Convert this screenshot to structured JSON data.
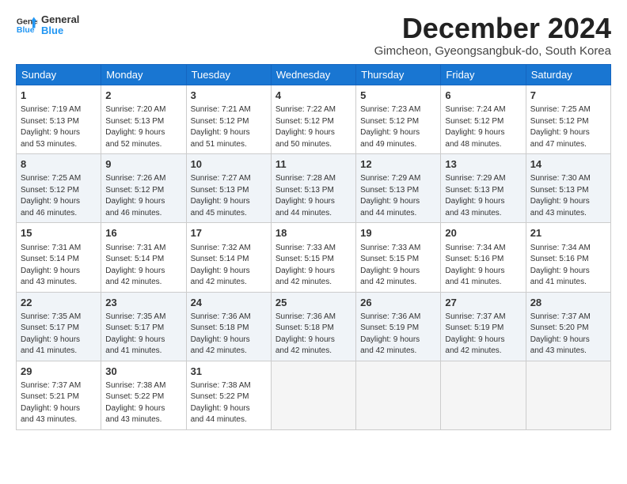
{
  "logo": {
    "line1": "General",
    "line2": "Blue"
  },
  "header": {
    "month": "December 2024",
    "location": "Gimcheon, Gyeongsangbuk-do, South Korea"
  },
  "weekdays": [
    "Sunday",
    "Monday",
    "Tuesday",
    "Wednesday",
    "Thursday",
    "Friday",
    "Saturday"
  ],
  "weeks": [
    [
      {
        "day": "1",
        "info": "Sunrise: 7:19 AM\nSunset: 5:13 PM\nDaylight: 9 hours\nand 53 minutes."
      },
      {
        "day": "2",
        "info": "Sunrise: 7:20 AM\nSunset: 5:13 PM\nDaylight: 9 hours\nand 52 minutes."
      },
      {
        "day": "3",
        "info": "Sunrise: 7:21 AM\nSunset: 5:12 PM\nDaylight: 9 hours\nand 51 minutes."
      },
      {
        "day": "4",
        "info": "Sunrise: 7:22 AM\nSunset: 5:12 PM\nDaylight: 9 hours\nand 50 minutes."
      },
      {
        "day": "5",
        "info": "Sunrise: 7:23 AM\nSunset: 5:12 PM\nDaylight: 9 hours\nand 49 minutes."
      },
      {
        "day": "6",
        "info": "Sunrise: 7:24 AM\nSunset: 5:12 PM\nDaylight: 9 hours\nand 48 minutes."
      },
      {
        "day": "7",
        "info": "Sunrise: 7:25 AM\nSunset: 5:12 PM\nDaylight: 9 hours\nand 47 minutes."
      }
    ],
    [
      {
        "day": "8",
        "info": "Sunrise: 7:25 AM\nSunset: 5:12 PM\nDaylight: 9 hours\nand 46 minutes."
      },
      {
        "day": "9",
        "info": "Sunrise: 7:26 AM\nSunset: 5:12 PM\nDaylight: 9 hours\nand 46 minutes."
      },
      {
        "day": "10",
        "info": "Sunrise: 7:27 AM\nSunset: 5:13 PM\nDaylight: 9 hours\nand 45 minutes."
      },
      {
        "day": "11",
        "info": "Sunrise: 7:28 AM\nSunset: 5:13 PM\nDaylight: 9 hours\nand 44 minutes."
      },
      {
        "day": "12",
        "info": "Sunrise: 7:29 AM\nSunset: 5:13 PM\nDaylight: 9 hours\nand 44 minutes."
      },
      {
        "day": "13",
        "info": "Sunrise: 7:29 AM\nSunset: 5:13 PM\nDaylight: 9 hours\nand 43 minutes."
      },
      {
        "day": "14",
        "info": "Sunrise: 7:30 AM\nSunset: 5:13 PM\nDaylight: 9 hours\nand 43 minutes."
      }
    ],
    [
      {
        "day": "15",
        "info": "Sunrise: 7:31 AM\nSunset: 5:14 PM\nDaylight: 9 hours\nand 43 minutes."
      },
      {
        "day": "16",
        "info": "Sunrise: 7:31 AM\nSunset: 5:14 PM\nDaylight: 9 hours\nand 42 minutes."
      },
      {
        "day": "17",
        "info": "Sunrise: 7:32 AM\nSunset: 5:14 PM\nDaylight: 9 hours\nand 42 minutes."
      },
      {
        "day": "18",
        "info": "Sunrise: 7:33 AM\nSunset: 5:15 PM\nDaylight: 9 hours\nand 42 minutes."
      },
      {
        "day": "19",
        "info": "Sunrise: 7:33 AM\nSunset: 5:15 PM\nDaylight: 9 hours\nand 42 minutes."
      },
      {
        "day": "20",
        "info": "Sunrise: 7:34 AM\nSunset: 5:16 PM\nDaylight: 9 hours\nand 41 minutes."
      },
      {
        "day": "21",
        "info": "Sunrise: 7:34 AM\nSunset: 5:16 PM\nDaylight: 9 hours\nand 41 minutes."
      }
    ],
    [
      {
        "day": "22",
        "info": "Sunrise: 7:35 AM\nSunset: 5:17 PM\nDaylight: 9 hours\nand 41 minutes."
      },
      {
        "day": "23",
        "info": "Sunrise: 7:35 AM\nSunset: 5:17 PM\nDaylight: 9 hours\nand 41 minutes."
      },
      {
        "day": "24",
        "info": "Sunrise: 7:36 AM\nSunset: 5:18 PM\nDaylight: 9 hours\nand 42 minutes."
      },
      {
        "day": "25",
        "info": "Sunrise: 7:36 AM\nSunset: 5:18 PM\nDaylight: 9 hours\nand 42 minutes."
      },
      {
        "day": "26",
        "info": "Sunrise: 7:36 AM\nSunset: 5:19 PM\nDaylight: 9 hours\nand 42 minutes."
      },
      {
        "day": "27",
        "info": "Sunrise: 7:37 AM\nSunset: 5:19 PM\nDaylight: 9 hours\nand 42 minutes."
      },
      {
        "day": "28",
        "info": "Sunrise: 7:37 AM\nSunset: 5:20 PM\nDaylight: 9 hours\nand 43 minutes."
      }
    ],
    [
      {
        "day": "29",
        "info": "Sunrise: 7:37 AM\nSunset: 5:21 PM\nDaylight: 9 hours\nand 43 minutes."
      },
      {
        "day": "30",
        "info": "Sunrise: 7:38 AM\nSunset: 5:22 PM\nDaylight: 9 hours\nand 43 minutes."
      },
      {
        "day": "31",
        "info": "Sunrise: 7:38 AM\nSunset: 5:22 PM\nDaylight: 9 hours\nand 44 minutes."
      },
      {
        "day": "",
        "info": ""
      },
      {
        "day": "",
        "info": ""
      },
      {
        "day": "",
        "info": ""
      },
      {
        "day": "",
        "info": ""
      }
    ]
  ]
}
